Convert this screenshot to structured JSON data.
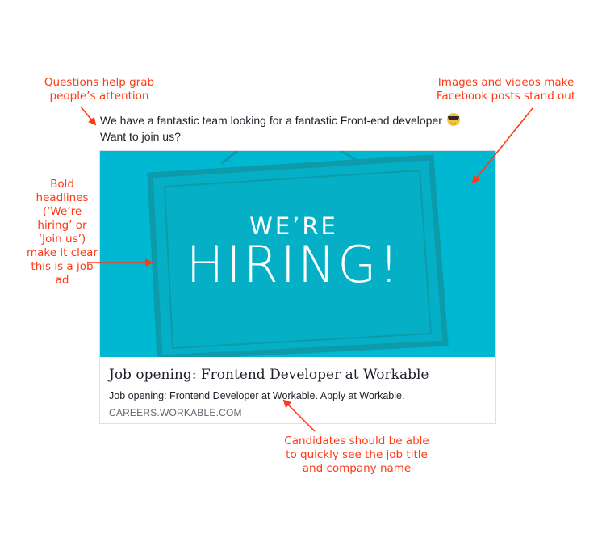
{
  "annotations": {
    "questions": "Questions help grab\npeople’s attention",
    "images": "Images and videos make\nFacebook posts stand out",
    "bold": "Bold\nheadlines\n(‘We’re\nhiring’ or\n‘Join us’)\nmake it clear\nthis is a job\nad",
    "candidates": "Candidates should be able\nto quickly see the job title\nand company name"
  },
  "post": {
    "line1": "We have a fantastic team looking for a fantastic Front-end developer",
    "line2": "Want to join us?",
    "emoji_icon": "sunglasses-emoji"
  },
  "card": {
    "image_text_line1": "WE’RE",
    "image_text_line2": "HIRING!",
    "title": "Job opening: Frontend Developer at Workable",
    "description": "Job opening: Frontend Developer at Workable. Apply at Workable.",
    "domain": "CAREERS.WORKABLE.COM"
  },
  "colors": {
    "annotation": "#ff3a13",
    "hero_background": "#00b8d1",
    "sign_border": "#0d9aaa"
  }
}
